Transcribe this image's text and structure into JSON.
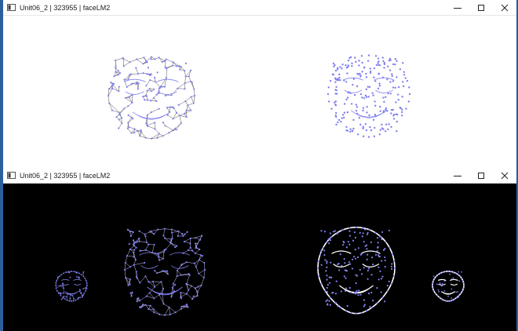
{
  "windows": [
    {
      "title": "Unit06_2 | 323955 | faceLM2",
      "canvas_background": "#ffffff",
      "mesh_color": "#8080f0",
      "wire_color": "#505050",
      "controls": [
        "minimize-icon",
        "maximize-icon",
        "close-icon"
      ]
    },
    {
      "title": "Unit06_2 | 323955 | faceLM2",
      "canvas_background": "#000000",
      "mesh_color": "#8080f0",
      "wire_color": "#c8c8ff",
      "controls": [
        "minimize-icon",
        "maximize-icon",
        "close-icon"
      ]
    }
  ],
  "desktop_background": "#2b5f9e"
}
